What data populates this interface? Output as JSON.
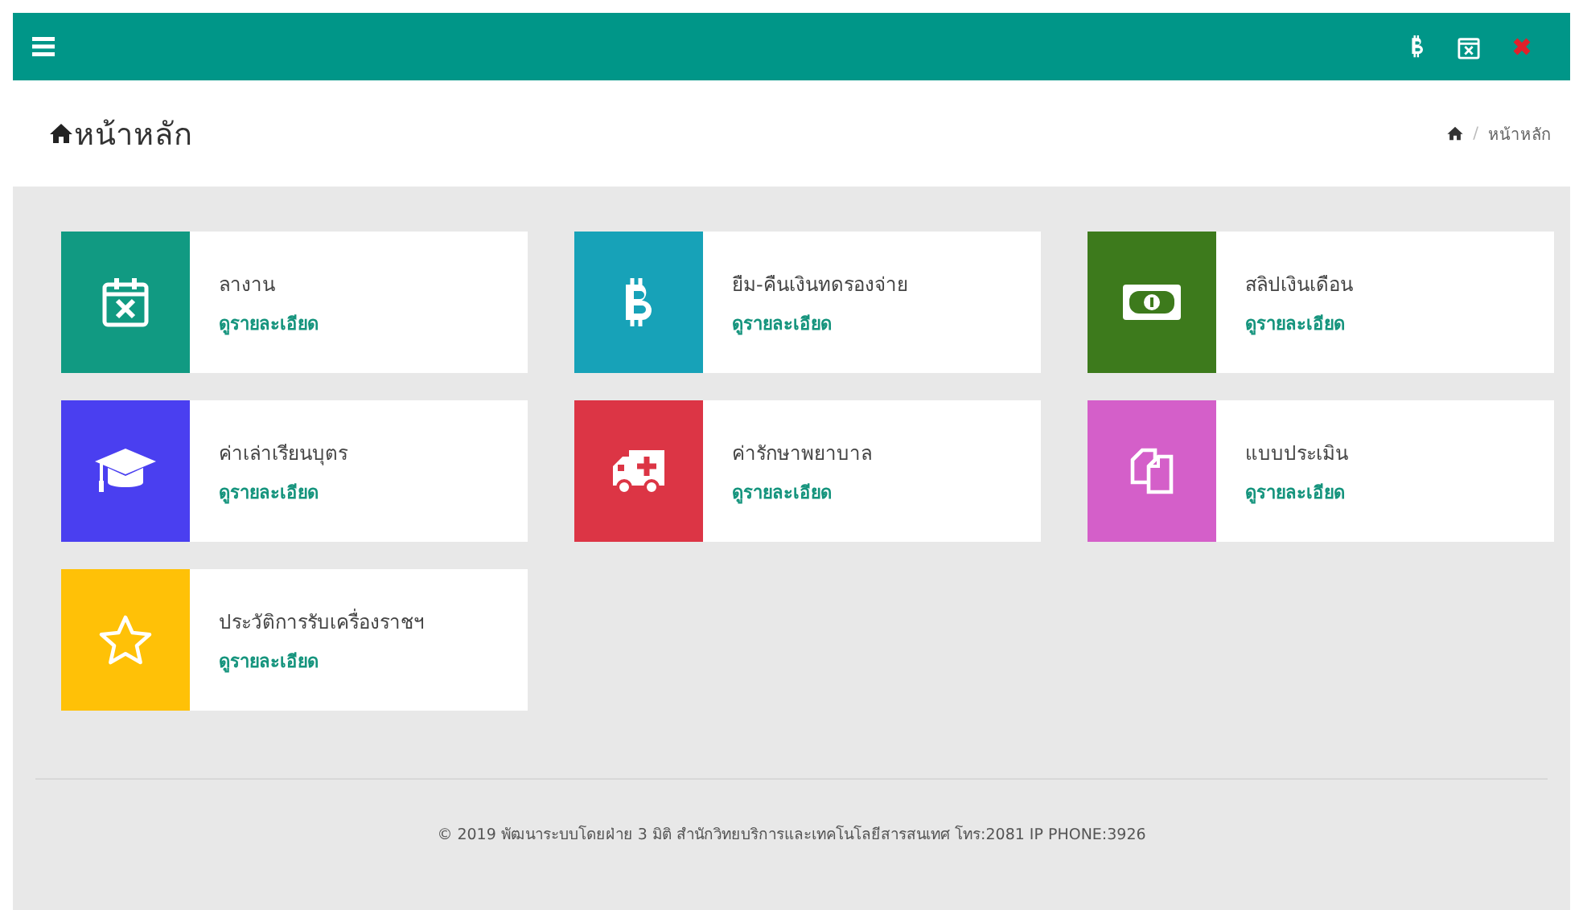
{
  "page_header": {
    "title": "หน้าหลัก",
    "separator": "/",
    "breadcrumb": "หน้าหลัก"
  },
  "cards": [
    {
      "color": "#119a82",
      "title": "ลางาน",
      "link": "ดูรายละเอียด"
    },
    {
      "color": "#17a2b8",
      "title": "ยืม-คืนเงินทดรองจ่าย",
      "link": "ดูรายละเอียด"
    },
    {
      "color": "#3d7a1c",
      "title": "สลิปเงินเดือน",
      "link": "ดูรายละเอียด"
    },
    {
      "color": "#4a3ff0",
      "title": "ค่าเล่าเรียนบุตร",
      "link": "ดูรายละเอียด"
    },
    {
      "color": "#dc3545",
      "title": "ค่ารักษาพยาบาล",
      "link": "ดูรายละเอียด"
    },
    {
      "color": "#d45fc9",
      "title": "แบบประเมิน",
      "link": "ดูรายละเอียด"
    },
    {
      "color": "#ffc107",
      "title": "ประวัติการรับเครื่องราชฯ",
      "link": "ดูรายละเอียด"
    }
  ],
  "footer": "© 2019 พัฒนาระบบโดยฝ่าย 3 มิติ สำนักวิทยบริการและเทคโนโลยีสารสนเทศ โทร:2081 IP PHONE:3926"
}
